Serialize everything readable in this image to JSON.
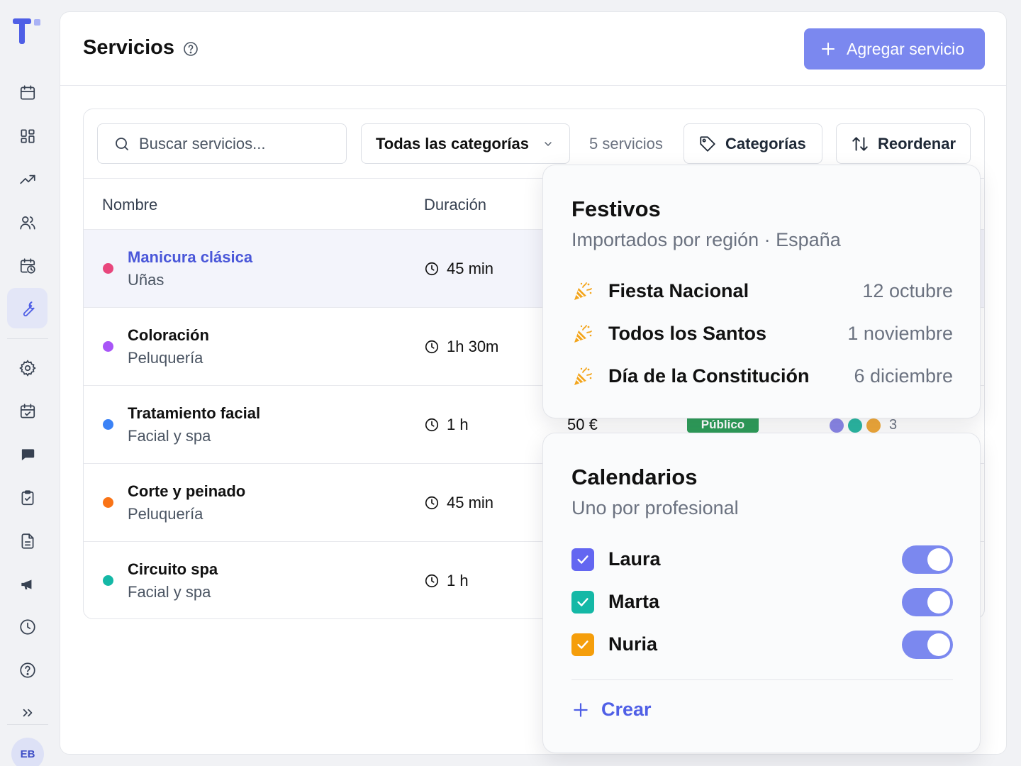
{
  "app": {
    "user_initials": "EB"
  },
  "header": {
    "title": "Servicios",
    "add_label": "Agregar servicio"
  },
  "toolbar": {
    "search_placeholder": "Buscar servicios...",
    "category_select": "Todas las categorías",
    "count_label": "5 servicios",
    "categories_label": "Categorías",
    "reorder_label": "Reordenar"
  },
  "table": {
    "columns": [
      "Nombre",
      "Duración"
    ],
    "rows": [
      {
        "name": "Manicura clásica",
        "category": "Uñas",
        "duration": "45 min",
        "color": "#e8467c"
      },
      {
        "name": "Coloración",
        "category": "Peluquería",
        "duration": "1h 30m",
        "color": "#a855f7"
      },
      {
        "name": "Tratamiento facial",
        "category": "Facial y spa",
        "duration": "1 h",
        "color": "#3b82f6"
      },
      {
        "name": "Corte y peinado",
        "category": "Peluquería",
        "duration": "45 min",
        "color": "#f97316"
      },
      {
        "name": "Circuito spa",
        "category": "Facial y spa",
        "duration": "1 h",
        "color": "#14b8a6"
      }
    ],
    "peek": {
      "price": "50 €",
      "badge": "Público",
      "avatar_count": "3",
      "avatar_colors": [
        "#8b87e8",
        "#2bb8a3",
        "#f0a93a"
      ]
    }
  },
  "holidays": {
    "title": "Festivos",
    "subtitle": "Importados por región · España",
    "items": [
      {
        "name": "Fiesta Nacional",
        "date": "12 octubre"
      },
      {
        "name": "Todos los Santos",
        "date": "1 noviembre"
      },
      {
        "name": "Día de la Constitución",
        "date": "6 diciembre"
      }
    ]
  },
  "calendars": {
    "title": "Calendarios",
    "subtitle": "Uno por profesional",
    "items": [
      {
        "name": "Laura",
        "color": "#6366f1",
        "enabled": true
      },
      {
        "name": "Marta",
        "color": "#14b8a6",
        "enabled": true
      },
      {
        "name": "Nuria",
        "color": "#f59e0b",
        "enabled": true
      }
    ],
    "create_label": "Crear"
  }
}
